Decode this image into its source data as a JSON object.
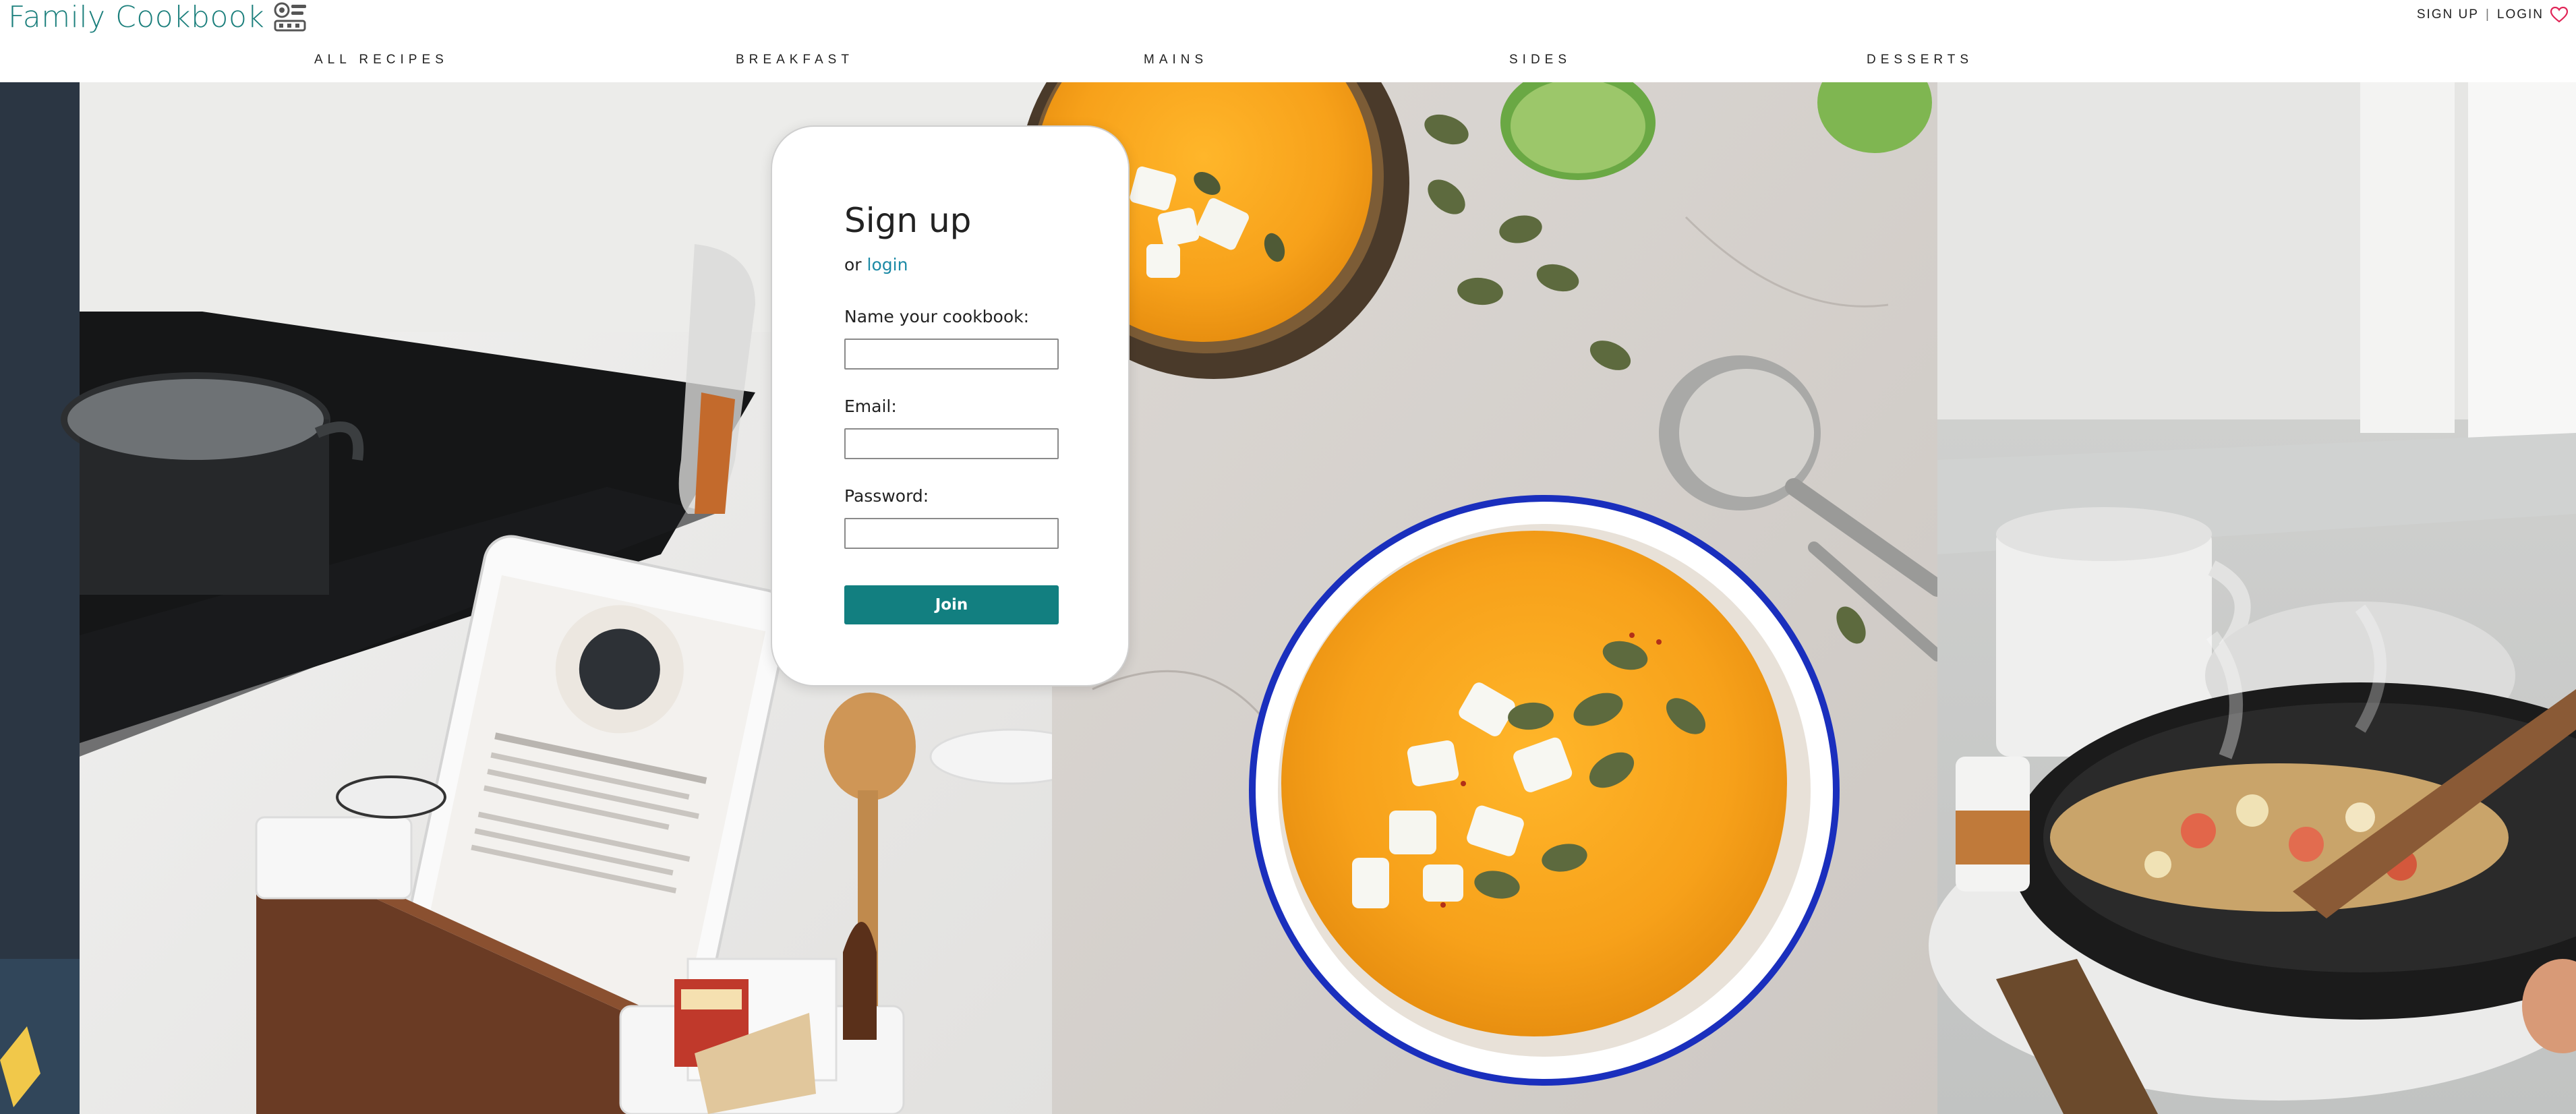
{
  "brand": {
    "name": "Family Cookbook",
    "icon": "chef-hat-icon",
    "color": "#1b7f7c"
  },
  "account": {
    "signup_label": "SIGN UP",
    "separator": "|",
    "login_label": "LOGIN",
    "heart_icon": "heart-icon",
    "heart_color": "#e02456"
  },
  "nav": {
    "items": [
      "ALL RECIPES",
      "BREAKFAST",
      "MAINS",
      "SIDES",
      "DESSERTS"
    ]
  },
  "signup_card": {
    "title": "Sign up",
    "alt_prefix": "or",
    "alt_link": "login",
    "fields": [
      {
        "label": "Name your cookbook:",
        "value": "",
        "placeholder": ""
      },
      {
        "label": "Email:",
        "value": "",
        "placeholder": ""
      },
      {
        "label": "Password:",
        "value": "",
        "placeholder": ""
      }
    ],
    "submit_label": "Join",
    "submit_color": "#127f80"
  },
  "hero": {
    "panels": [
      "kitchen-counter-tablet-photo",
      "pumpkin-soup-bowls-photo",
      "stir-fry-pan-photo"
    ]
  }
}
